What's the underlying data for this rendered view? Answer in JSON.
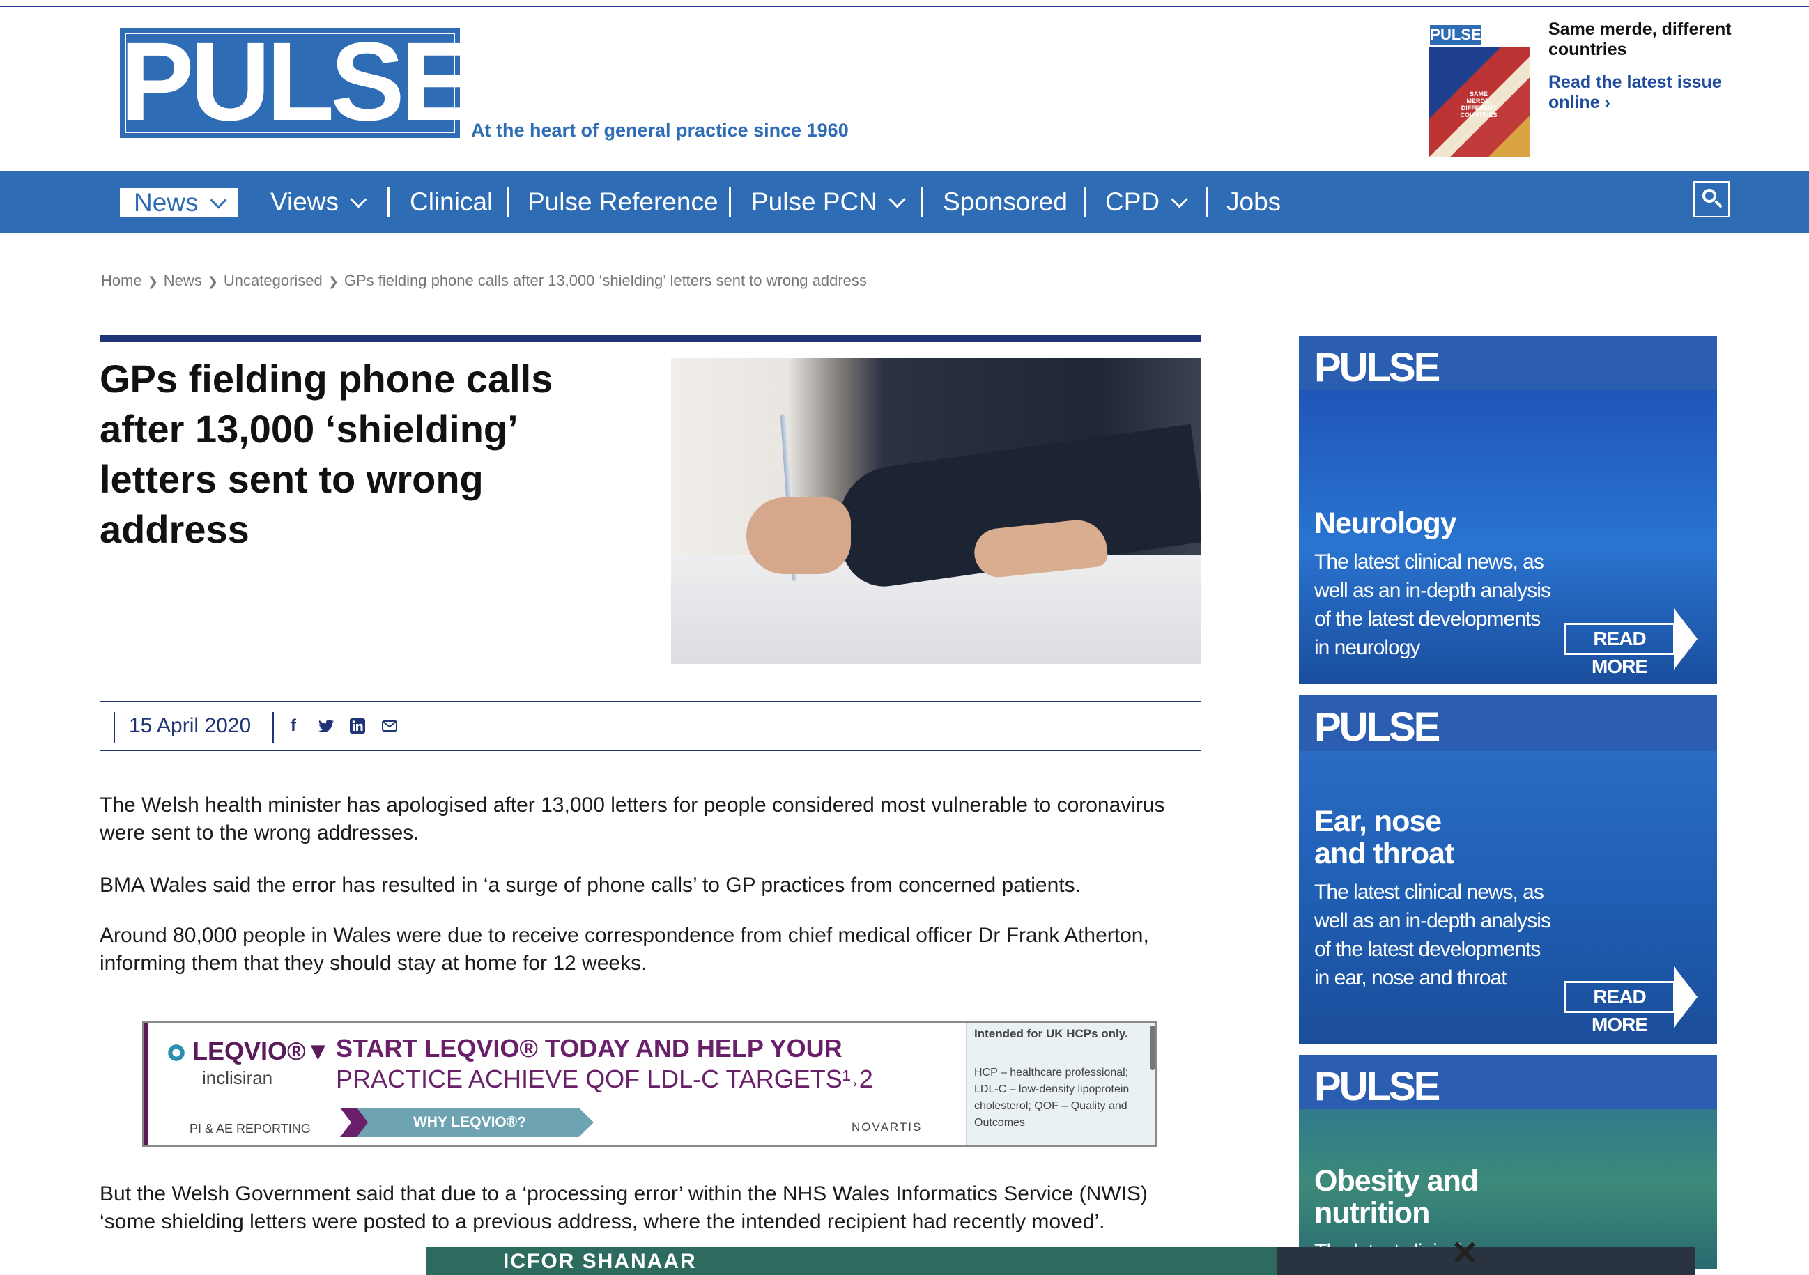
{
  "header": {
    "logo": "PULSE",
    "tagline": "At the heart of general practice since 1960",
    "magazine": {
      "cover_logo": "PULSE",
      "cover_text": "SAME MERDE, DIFFERENT COUNTRIES",
      "promo_title": "Same merde, different countries",
      "promo_link": "Read the latest issue online ›"
    }
  },
  "nav": {
    "items": [
      {
        "label": "News",
        "active": true,
        "dropdown": true
      },
      {
        "label": "Views",
        "dropdown": true
      },
      {
        "label": "Clinical"
      },
      {
        "label": "Pulse Reference"
      },
      {
        "label": "Pulse PCN",
        "dropdown": true
      },
      {
        "label": "Sponsored"
      },
      {
        "label": "CPD",
        "dropdown": true
      },
      {
        "label": "Jobs"
      }
    ],
    "search_icon": "search-icon"
  },
  "breadcrumb": [
    "Home",
    "News",
    "Uncategorised",
    "GPs fielding phone calls after 13,000 ‘shielding’ letters sent to wrong address"
  ],
  "article": {
    "title": "GPs fielding phone calls after 13,000 ‘shielding’ letters sent to wrong address",
    "date": "15 April 2020",
    "share": [
      "facebook-icon",
      "twitter-icon",
      "linkedin-icon",
      "email-icon"
    ],
    "paragraphs": [
      "The Welsh health minister has apologised after 13,000 letters for people considered most vulnerable to coronavirus were sent to the wrong addresses.",
      "BMA Wales said the error has resulted in ‘a surge of phone calls’ to GP practices from concerned patients.",
      "Around 80,000 people in Wales were due to receive correspondence from chief medical officer Dr Frank Atherton, informing them that they should stay at home for 12 weeks.",
      "But the Welsh Government said that due to a ‘processing error’ within the NHS Wales Informatics Service (NWIS) ‘some shielding letters were posted to a previous address, where the intended recipient had recently moved’."
    ]
  },
  "ad": {
    "brand": "LEQVIO®",
    "generic": "inclisiran",
    "pi_link": "PI & AE REPORTING",
    "headline_1": "START LEQVIO® TODAY AND HELP YOUR",
    "headline_2": "PRACTICE ACHIEVE QOF LDL-C TARGETS¹˒2",
    "cta": "WHY LEQVIO®?",
    "sponsor": "NOVARTIS",
    "box_title": "Intended for UK HCPs only.",
    "box_text": "HCP – healthcare professional; LDL-C – low-density lipoprotein cholesterol; QOF – Quality and Outcomes"
  },
  "sidebar": {
    "cards": [
      {
        "logo": "PULSE",
        "title": "Neurology",
        "desc": "The latest clinical news, as well as an in-depth analysis of the latest developments in neurology",
        "cta": "READ MORE"
      },
      {
        "logo": "PULSE",
        "title": "Ear, nose and throat",
        "desc": "The latest clinical news, as well as an in-depth analysis of the latest developments in ear, nose and throat",
        "cta": "READ MORE"
      },
      {
        "logo": "PULSE",
        "title": "Obesity and nutrition",
        "desc": "The latest clinical news,",
        "cta": ""
      }
    ]
  },
  "overlay": {
    "text": "ICFOR   SHANAAR",
    "close": "✕"
  },
  "colors": {
    "brand_blue": "#2e6db5",
    "navy": "#1f3576",
    "ad_purple": "#6a1f6a"
  }
}
